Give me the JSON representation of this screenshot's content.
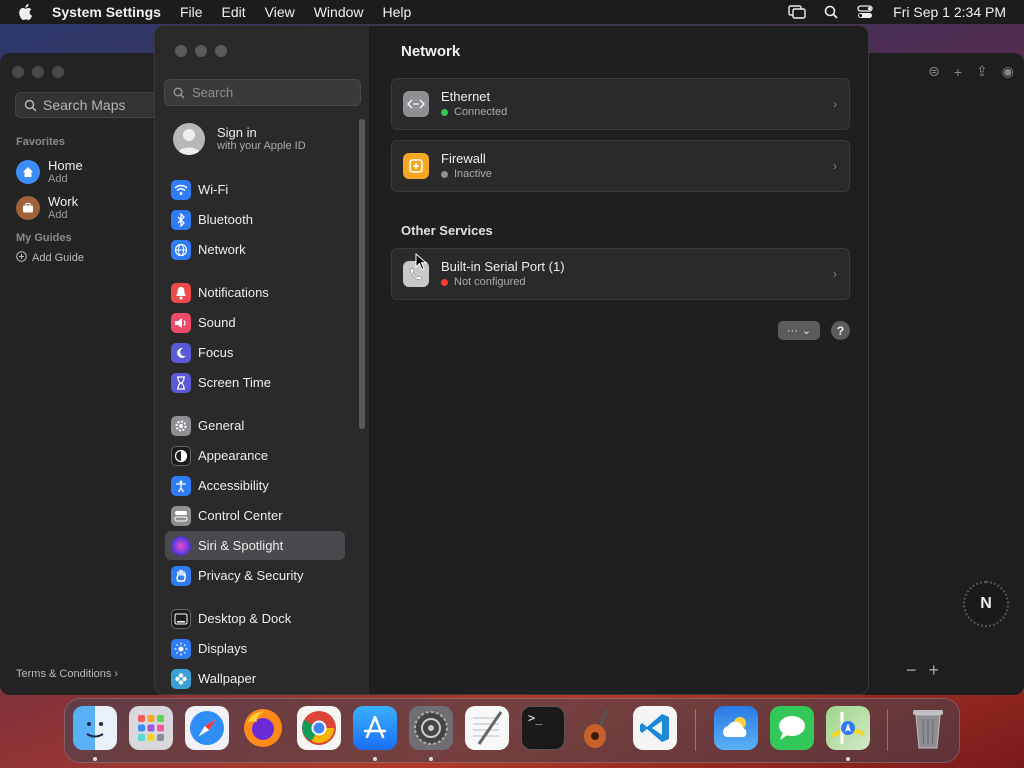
{
  "menubar": {
    "app_name": "System Settings",
    "menus": [
      "File",
      "Edit",
      "View",
      "Window",
      "Help"
    ],
    "clock": "Fri Sep 1  2:34 PM"
  },
  "maps": {
    "search_placeholder": "Search Maps",
    "favorites_label": "Favorites",
    "favorites": [
      {
        "title": "Home",
        "subtitle": "Add",
        "color": "#3a8ef6"
      },
      {
        "title": "Work",
        "subtitle": "Add",
        "color": "#a0623a"
      }
    ],
    "guides_label": "My Guides",
    "add_guide": "Add Guide",
    "terms": "Terms & Conditions",
    "compass": "N"
  },
  "settings": {
    "search_placeholder": "Search",
    "account": {
      "name": "Sign in",
      "subtitle": "with your Apple ID"
    },
    "sidebar": [
      {
        "label": "Wi-Fi",
        "icon": "wifi-icon",
        "color": "#2f7cf6"
      },
      {
        "label": "Bluetooth",
        "icon": "bluetooth-icon",
        "color": "#2f7cf6"
      },
      {
        "label": "Network",
        "icon": "globe-icon",
        "color": "#2f7cf6"
      },
      {
        "label": "Notifications",
        "icon": "bell-icon",
        "color": "#ee4a4a"
      },
      {
        "label": "Sound",
        "icon": "speaker-icon",
        "color": "#ee4a6a"
      },
      {
        "label": "Focus",
        "icon": "moon-icon",
        "color": "#5a5ad6"
      },
      {
        "label": "Screen Time",
        "icon": "hourglass-icon",
        "color": "#5a5ad6"
      },
      {
        "label": "General",
        "icon": "gear-icon",
        "color": "#8e8e93"
      },
      {
        "label": "Appearance",
        "icon": "appearance-icon",
        "color": "#1c1c1e"
      },
      {
        "label": "Accessibility",
        "icon": "accessibility-icon",
        "color": "#2f7cf6"
      },
      {
        "label": "Control Center",
        "icon": "control-center-icon",
        "color": "#8e8e93"
      },
      {
        "label": "Siri & Spotlight",
        "icon": "siri-icon",
        "color": "#c03aa0"
      },
      {
        "label": "Privacy & Security",
        "icon": "hand-icon",
        "color": "#2f7cf6"
      },
      {
        "label": "Desktop & Dock",
        "icon": "dock-icon",
        "color": "#1c1c1e"
      },
      {
        "label": "Displays",
        "icon": "sun-icon",
        "color": "#2f7cf6"
      },
      {
        "label": "Wallpaper",
        "icon": "flower-icon",
        "color": "#3aa0d6"
      }
    ],
    "selected_item": "Siri & Spotlight",
    "main": {
      "title": "Network",
      "services": [
        {
          "name": "Ethernet",
          "status": "Connected",
          "status_color": "#34c759",
          "icon": "ethernet-icon",
          "icon_color": "#8e8e93"
        },
        {
          "name": "Firewall",
          "status": "Inactive",
          "status_color": "#8e8e93",
          "icon": "firewall-icon",
          "icon_color": "#f5a623"
        }
      ],
      "other_title": "Other Services",
      "other_services": [
        {
          "name": "Built-in Serial Port (1)",
          "status": "Not configured",
          "status_color": "#ff3b30",
          "icon": "phone-icon",
          "icon_color": "#c8c8c8"
        }
      ],
      "more_button": "···",
      "help_button": "?"
    }
  },
  "dock": {
    "apps": [
      "Finder",
      "Launchpad",
      "Safari",
      "Firefox",
      "Chrome",
      "App Store",
      "System Settings",
      "TextEdit",
      "Terminal",
      "GarageBand",
      "Visual Studio Code",
      "Weather",
      "Messages",
      "Maps",
      "Trash"
    ]
  }
}
